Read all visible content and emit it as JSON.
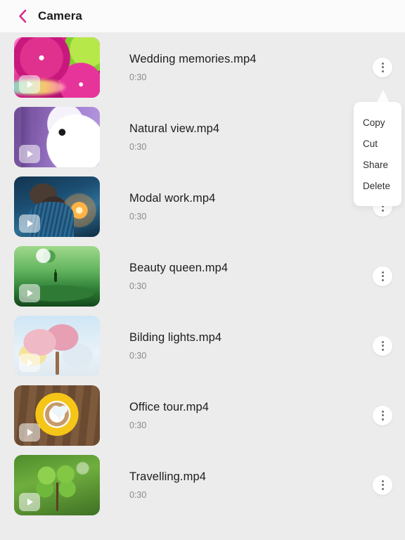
{
  "header": {
    "back_icon": "chevron-left-icon",
    "back_color": "#d62e8a",
    "title": "Camera"
  },
  "colors": {
    "page_background": "#ececec",
    "header_background": "#fbfbfb",
    "accent": "#d62e8a",
    "title_text": "#1d1d1f",
    "secondary_text": "#8a8a8e",
    "menu_background": "#ffffff"
  },
  "list": {
    "items": [
      {
        "name": "Wedding memories.mp4",
        "duration": "0:30",
        "art": "art-citrus",
        "play_icon": "play-icon",
        "menu_icon": "kebab-menu-icon"
      },
      {
        "name": "Natural view.mp4",
        "duration": "0:30",
        "art": "art-bunny",
        "play_icon": "play-icon",
        "menu_icon": "kebab-menu-icon"
      },
      {
        "name": "Modal work.mp4",
        "duration": "0:30",
        "art": "art-woman",
        "play_icon": "play-icon",
        "menu_icon": "kebab-menu-icon"
      },
      {
        "name": "Beauty queen.mp4",
        "duration": "0:30",
        "art": "art-green",
        "play_icon": "play-icon",
        "menu_icon": "kebab-menu-icon"
      },
      {
        "name": "Bilding lights.mp4",
        "duration": "0:30",
        "art": "art-trees",
        "play_icon": "play-icon",
        "menu_icon": "kebab-menu-icon"
      },
      {
        "name": "Office tour.mp4",
        "duration": "0:30",
        "art": "art-coffee",
        "play_icon": "play-icon",
        "menu_icon": "kebab-menu-icon"
      },
      {
        "name": "Travelling.mp4",
        "duration": "0:30",
        "art": "art-clover",
        "play_icon": "play-icon",
        "menu_icon": "kebab-menu-icon"
      }
    ]
  },
  "context_menu": {
    "open": true,
    "anchored_to_item_index": 0,
    "options": [
      {
        "label": "Copy"
      },
      {
        "label": "Cut"
      },
      {
        "label": "Share"
      },
      {
        "label": "Delete"
      }
    ]
  }
}
